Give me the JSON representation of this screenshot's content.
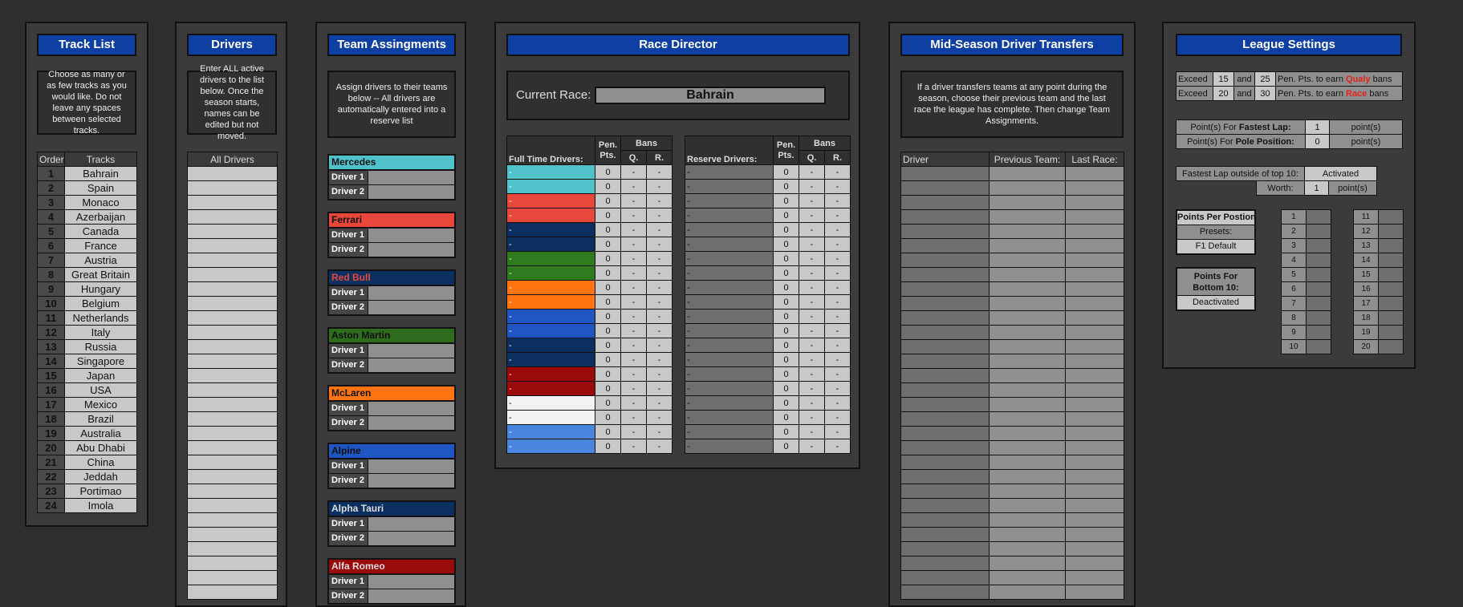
{
  "track_list": {
    "title": "Track List",
    "description": "Choose as many or as few tracks as you would like. Do not leave any spaces between selected tracks.",
    "col_order": "Order",
    "col_tracks": "Tracks",
    "tracks": [
      "Bahrain",
      "Spain",
      "Monaco",
      "Azerbaijan",
      "Canada",
      "France",
      "Austria",
      "Great Britain",
      "Hungary",
      "Belgium",
      "Netherlands",
      "Italy",
      "Russia",
      "Singapore",
      "Japan",
      "USA",
      "Mexico",
      "Brazil",
      "Australia",
      "Abu Dhabi",
      "China",
      "Jeddah",
      "Portimao",
      "Imola"
    ],
    "orders": [
      "1",
      "2",
      "3",
      "4",
      "5",
      "6",
      "7",
      "8",
      "9",
      "10",
      "11",
      "12",
      "13",
      "14",
      "15",
      "16",
      "17",
      "18",
      "19",
      "20",
      "21",
      "22",
      "23",
      "24"
    ]
  },
  "drivers": {
    "title": "Drivers",
    "description": "Enter ALL active drivers to the list below. Once the season starts, names can be edited but not moved.",
    "col_all": "All Drivers"
  },
  "team_assignments": {
    "title": "Team Assingments",
    "description": "Assign drivers to their teams below -- All drivers are automatically entered into a reserve list",
    "driver1_label": "Driver 1",
    "driver2_label": "Driver 2",
    "teams": [
      {
        "name": "Mercedes",
        "bg": "#4fc3c9",
        "fg": "#111111"
      },
      {
        "name": "Ferrari",
        "bg": "#e8473c",
        "fg": "#111111"
      },
      {
        "name": "Red Bull",
        "bg": "#0b2f5f",
        "fg": "#e8473c"
      },
      {
        "name": "Aston Martin",
        "bg": "#2e6b1c",
        "fg": "#111111"
      },
      {
        "name": "McLaren",
        "bg": "#ff7410",
        "fg": "#111111"
      },
      {
        "name": "Alpine",
        "bg": "#1f56c4",
        "fg": "#111111"
      },
      {
        "name": "Alpha Tauri",
        "bg": "#0b2f5f",
        "fg": "#dddddd"
      },
      {
        "name": "Alfa Romeo",
        "bg": "#9a0a0a",
        "fg": "#dddddd"
      }
    ]
  },
  "race_director": {
    "title": "Race Director",
    "current_race_label": "Current Race:",
    "current_race": "Bahrain",
    "full_time_header": "Full Time Drivers:",
    "reserve_header": "Reserve Drivers:",
    "pen_pts": "Pen. Pts.",
    "bans": "Bans",
    "q": "Q.",
    "r": "R.",
    "dash": "-",
    "zero": "0",
    "full_time_colors": [
      "#4fc3c9",
      "#4fc3c9",
      "#e8473c",
      "#e8473c",
      "#0b2f5f",
      "#0b2f5f",
      "#2e7a1c",
      "#2e7a1c",
      "#ff7410",
      "#ff7410",
      "#1f56c4",
      "#1f56c4",
      "#0b2f5f",
      "#0b2f5f",
      "#9a0a0a",
      "#9a0a0a",
      "#f2f2f2",
      "#f2f2f2",
      "#4a86e0",
      "#4a86e0"
    ]
  },
  "transfers": {
    "title": "Mid-Season Driver Transfers",
    "description": "If a driver transfers teams at any point during the season, choose their previous team and the last race the league has complete. Then change Team Assignments.",
    "col_driver": "Driver",
    "col_prev": "Previous Team:",
    "col_last": "Last Race:"
  },
  "league_settings": {
    "title": "League Settings",
    "exceed": "Exceed",
    "and": "and",
    "row1": {
      "a": "15",
      "b": "25",
      "text": "Pen. Pts. to earn ",
      "highlight": "Qualy",
      "tail": " bans"
    },
    "row2": {
      "a": "20",
      "b": "30",
      "text": "Pen. Pts. to earn ",
      "highlight": "Race",
      "tail": " bans"
    },
    "fastest_lap_label_pre": "Point(s) For ",
    "fastest_lap_bold": "Fastest Lap:",
    "fastest_lap_value": "1",
    "pole_label_pre": "Point(s) For ",
    "pole_bold": "Pole Position:",
    "pole_value": "0",
    "points_unit": "point(s)",
    "fl_outside_label": "Fastest Lap outside of top 10:",
    "fl_outside_value": "Activated",
    "worth_label": "Worth:",
    "worth_value": "1",
    "ppp_title": "Points Per Postion",
    "presets_label": "Presets:",
    "presets_value": "F1 Default",
    "bottom_title": "Points For Bottom 10:",
    "bottom_value": "Deactivated",
    "positions_left": [
      "1",
      "2",
      "3",
      "4",
      "5",
      "6",
      "7",
      "8",
      "9",
      "10"
    ],
    "positions_right": [
      "11",
      "12",
      "13",
      "14",
      "15",
      "16",
      "17",
      "18",
      "19",
      "20"
    ]
  }
}
